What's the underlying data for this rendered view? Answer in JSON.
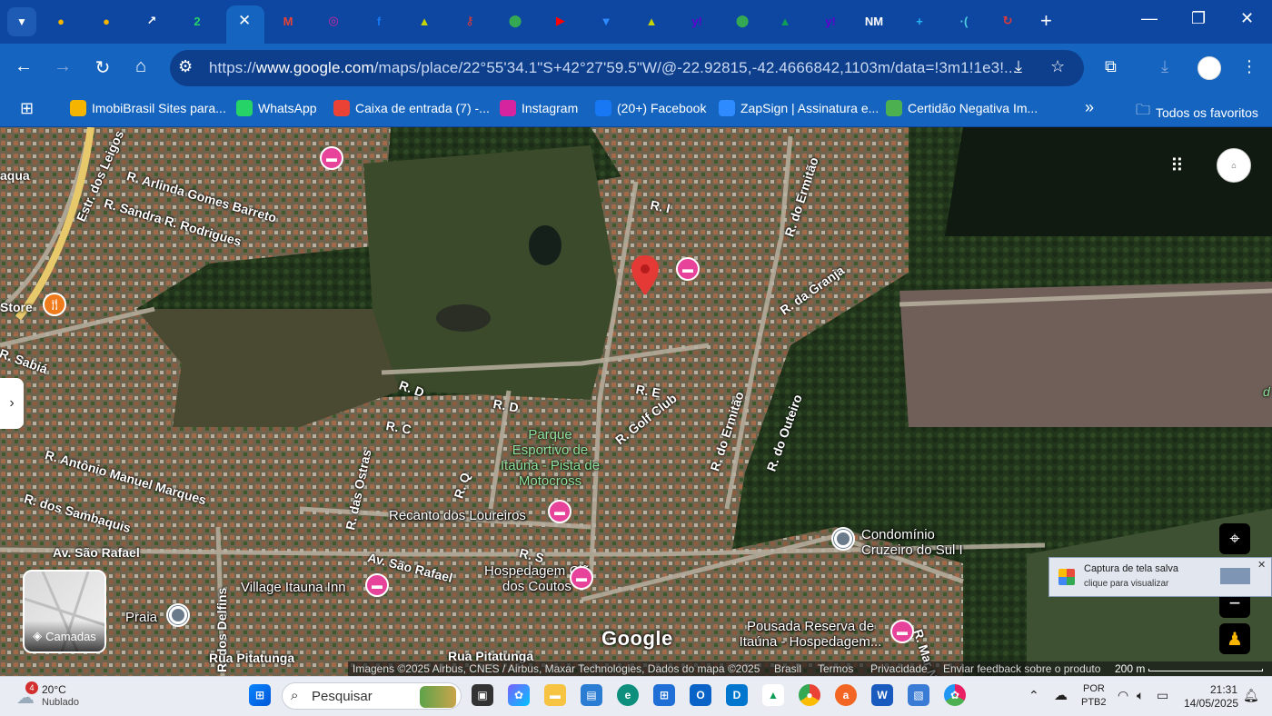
{
  "browser": {
    "tab_close_glyph": "✕",
    "tabs": [
      {
        "icon": "imobibrasil-icon",
        "color": "#f4b400",
        "glyph": "●"
      },
      {
        "icon": "imobibrasil-icon",
        "color": "#f4b400",
        "glyph": "●"
      },
      {
        "icon": "chart-icon",
        "color": "#ffffff",
        "glyph": "↗"
      },
      {
        "icon": "whatsapp-icon",
        "color": "#25d366",
        "glyph": "2"
      },
      {
        "icon": "gmail-icon",
        "color": "#ea4335",
        "glyph": "M"
      },
      {
        "icon": "instagram-icon",
        "color": "#d6249f",
        "glyph": "◎"
      },
      {
        "icon": "facebook-icon",
        "color": "#1877f2",
        "glyph": "f"
      },
      {
        "icon": "triangle-icon",
        "color": "#c6d400",
        "glyph": "▲"
      },
      {
        "icon": "key-icon",
        "color": "#e53935",
        "glyph": "⚷"
      },
      {
        "icon": "maps-icon",
        "color": "#34a853",
        "glyph": "⬤"
      },
      {
        "icon": "youtube-icon",
        "color": "#ff0000",
        "glyph": "▶"
      },
      {
        "icon": "zapsign-icon",
        "color": "#2e8bff",
        "glyph": "▼"
      },
      {
        "icon": "triangle-icon",
        "color": "#c6d400",
        "glyph": "▲"
      },
      {
        "icon": "yahoo-icon",
        "color": "#6001d2",
        "glyph": "y!"
      },
      {
        "icon": "maps-icon",
        "color": "#34a853",
        "glyph": "⬤"
      },
      {
        "icon": "drive-icon",
        "color": "#0f9d58",
        "glyph": "▲"
      },
      {
        "icon": "yahoo-icon",
        "color": "#6001d2",
        "glyph": "y!"
      },
      {
        "icon": "nm-icon",
        "color": "#ffffff",
        "glyph": "NM"
      },
      {
        "icon": "plus-box-icon",
        "color": "#29b6f6",
        "glyph": "+"
      },
      {
        "icon": "dot-icon",
        "color": "#4dd0e1",
        "glyph": "·("
      },
      {
        "icon": "refresh-red-icon",
        "color": "#e53935",
        "glyph": "↻"
      }
    ],
    "url_prefix": "https://",
    "url_host": "www.google.com",
    "url_path": "/maps/place/22°55'34.1\"S+42°27'59.5\"W/@-22.92815,-42.4666842,1103m/data=!3m1!1e3!...",
    "bookmarks": [
      {
        "label": "ImobiBrasil Sites para...",
        "icon": "imobibrasil-icon",
        "color": "#f4b400"
      },
      {
        "label": "WhatsApp",
        "icon": "whatsapp-icon",
        "color": "#25d366"
      },
      {
        "label": "Caixa de entrada (7) -...",
        "icon": "gmail-icon",
        "color": "#ea4335"
      },
      {
        "label": "Instagram",
        "icon": "instagram-icon",
        "color": "#d6249f"
      },
      {
        "label": "(20+) Facebook",
        "icon": "facebook-icon",
        "color": "#1877f2"
      },
      {
        "label": "ZapSign | Assinatura e...",
        "icon": "zapsign-icon",
        "color": "#2e8bff"
      },
      {
        "label": "Certidão Negativa Im...",
        "icon": "seal-icon",
        "color": "#4caf50"
      }
    ],
    "bookmarks_more": "»",
    "all_bookmarks": "Todos os favoritos"
  },
  "map": {
    "streets": [
      {
        "text": "aqua"
      },
      {
        "text": "Estr. dos Leigos"
      },
      {
        "text": "R. Arlinda Gomes Barreto"
      },
      {
        "text": "R. Sandra R. Rodrigues"
      },
      {
        "text": "Store"
      },
      {
        "text": "R. Sabiá"
      },
      {
        "text": "R. I"
      },
      {
        "text": "R. do Ermitão"
      },
      {
        "text": "R. da Granja"
      },
      {
        "text": "R. D"
      },
      {
        "text": "R. D"
      },
      {
        "text": "R. E"
      },
      {
        "text": "R. Golf Club"
      },
      {
        "text": "R. C"
      },
      {
        "text": "R. do Ermitão"
      },
      {
        "text": "R. do Outeiro"
      },
      {
        "text": "R. Antônio Manuel Marques"
      },
      {
        "text": "R. das Ostras"
      },
      {
        "text": "R. Q"
      },
      {
        "text": "R. dos Sambaquis"
      },
      {
        "text": "Av. São Rafael"
      },
      {
        "text": "Av. São Rafael"
      },
      {
        "text": "R. S"
      },
      {
        "text": "R. dos Delfins"
      },
      {
        "text": "Rua Pitatunga"
      },
      {
        "text": "Rua Pitatunga"
      },
      {
        "text": "R. Mar N"
      },
      {
        "text": "d"
      }
    ],
    "park": "Parque Esportivo de Itaúna - Pista de Motocross",
    "places": [
      {
        "name": "Recanto dos Loureiros",
        "type": "hotel"
      },
      {
        "name": "Village Itauna Inn",
        "type": "hotel"
      },
      {
        "name": "Hospedagem Clã dos Coutos",
        "type": "hotel"
      },
      {
        "name": "Condomínio Cruzeiro do Sul I",
        "type": "place"
      },
      {
        "name": "Pousada Reserva de Itaúna - Hospedagem...",
        "type": "hotel"
      },
      {
        "name": "Praia",
        "type": "place"
      }
    ],
    "layers_label": "Camadas",
    "google_logo": "Google",
    "attribution": "Imagens ©2025 Airbus, CNES / Airbus, Maxar Technologies, Dados do mapa ©2025",
    "footer_links": [
      "Brasil",
      "Termos",
      "Privacidade",
      "Enviar feedback sobre o produto"
    ],
    "scale": "200 m",
    "toast_title": "Captura de tela salva",
    "toast_sub": "clique para visualizar",
    "marker_color": "#e53935",
    "hotel_color": "#e8439b"
  },
  "taskbar": {
    "weather_badge": "4",
    "temperature": "20°C",
    "condition": "Nublado",
    "search_placeholder": "Pesquisar",
    "lang_top": "POR",
    "lang_bottom": "PTB2",
    "time": "21:31",
    "date": "14/05/2025"
  }
}
